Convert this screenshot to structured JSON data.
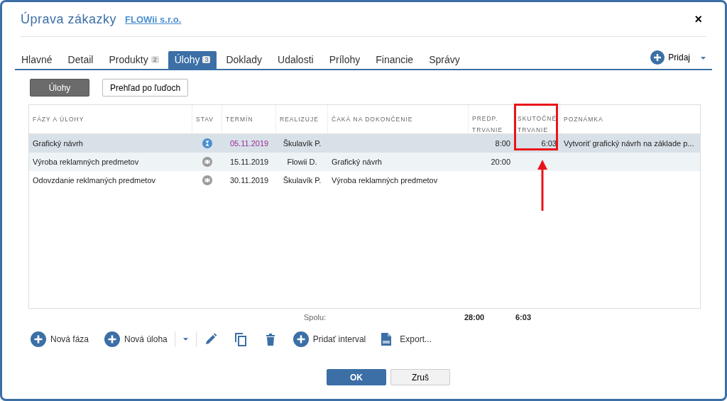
{
  "window": {
    "title": "Úprava zákazky",
    "link": "FLOWii s.r.o.",
    "close": "×"
  },
  "tabs": [
    {
      "label": "Hlavné",
      "selected": false
    },
    {
      "label": "Detail",
      "selected": false
    },
    {
      "label": "Produkty",
      "badge": "2",
      "selected": false
    },
    {
      "label": "Úlohy",
      "badge": "3",
      "selected": true
    },
    {
      "label": "Doklady",
      "selected": false
    },
    {
      "label": "Udalosti",
      "selected": false
    },
    {
      "label": "Prílohy",
      "selected": false
    },
    {
      "label": "Financie",
      "selected": false
    },
    {
      "label": "Správy",
      "selected": false
    }
  ],
  "add_button": "Pridaj",
  "views": [
    {
      "label": "Úlohy",
      "selected": true
    },
    {
      "label": "Prehľad po ľuďoch",
      "selected": false
    }
  ],
  "table": {
    "columns": [
      [
        "FÁZY A ÚLOHY"
      ],
      [
        "STAV"
      ],
      [
        "TERMÍN"
      ],
      [
        "REALIZUJE"
      ],
      [
        "ČAKÁ NA DOKONČENIE"
      ],
      [
        "PREDP.",
        "TRVANIE"
      ],
      [
        "SKUTOČNÉ",
        "TRVANIE"
      ],
      [
        "POZNÁMKA"
      ]
    ],
    "rows": [
      {
        "name": "Grafický návrh",
        "kind": "running",
        "due": "05.11.2019",
        "due_highlighted": true,
        "assignee": "Škulavík P.",
        "waits_for": "",
        "planned": "8:00",
        "actual": "6:03",
        "note": "Vytvoriť grafický návrh na základe p...",
        "selected": true
      },
      {
        "name": "Výroba reklamných predmetov",
        "kind": "waiting",
        "due": "15.11.2019",
        "due_highlighted": false,
        "assignee": "Flowii D.",
        "waits_for": "Grafický návrh",
        "planned": "20:00",
        "actual": "",
        "note": "",
        "selected": false
      },
      {
        "name": "Odovzdanie reklmaných predmetov",
        "kind": "waiting",
        "due": "30.11.2019",
        "due_highlighted": false,
        "assignee": "Škulavík P.",
        "waits_for": "Výroba reklamných predmetov",
        "planned": "",
        "actual": "",
        "note": "",
        "selected": false
      }
    ],
    "totals": {
      "label": "Spolu:",
      "planned": "28:00",
      "actual": "6:03"
    }
  },
  "toolbar": [
    {
      "kind": "add",
      "label": "Nová fáza"
    },
    {
      "kind": "add-split",
      "label": "Nová úloha"
    },
    {
      "kind": "edit"
    },
    {
      "kind": "copy"
    },
    {
      "kind": "delete"
    },
    {
      "kind": "add",
      "label": "Pridať interval"
    },
    {
      "kind": "export",
      "label": "Export..."
    }
  ],
  "buttons": [
    {
      "label": "OK",
      "primary": true
    },
    {
      "label": "Zruš",
      "primary": false
    }
  ]
}
